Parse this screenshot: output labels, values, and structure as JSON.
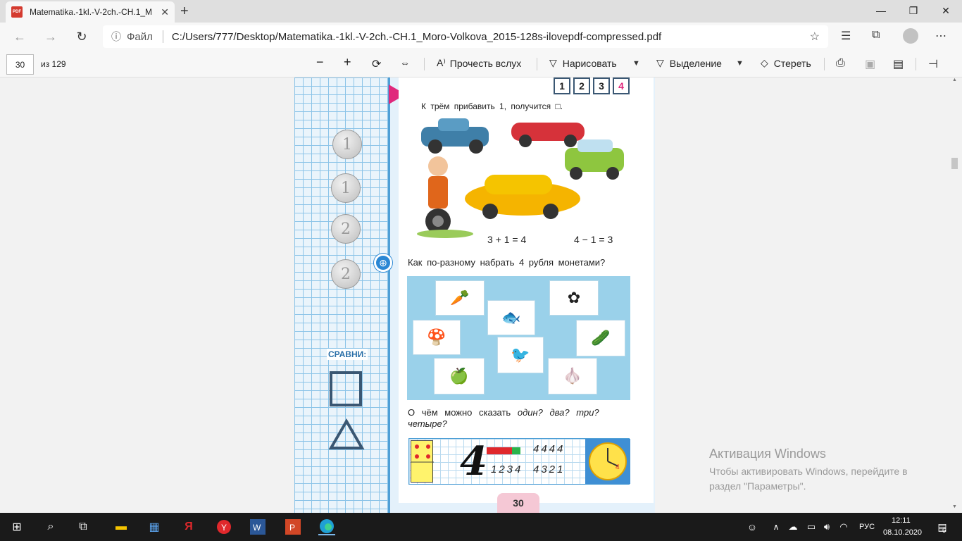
{
  "browser": {
    "tab_title": "Matematika.-1kl.-V-2ch.-CH.1_M",
    "pdf_badge": "PDF",
    "new_tab_symbol": "+",
    "tab_close_symbol": "✕",
    "window_controls": {
      "minimize": "—",
      "restore": "❐",
      "close": "✕"
    }
  },
  "address": {
    "label": "Файл",
    "url": "C:/Users/777/Desktop/Matematika.-1kl.-V-2ch.-CH.1_Moro-Volkova_2015-128s-ilovepdf-compressed.pdf"
  },
  "pdf_toolbar": {
    "page_current": "30",
    "page_total": "из 129",
    "read_aloud": "Прочесть вслух",
    "draw": "Нарисовать",
    "highlight": "Выделение",
    "erase": "Стереть"
  },
  "page": {
    "number_boxes": [
      "1",
      "2",
      "3",
      "4"
    ],
    "line1": "К трём прибавить 1, получится □.",
    "eq1": "3 + 1 = 4",
    "eq2": "4 − 1 = 3",
    "question2": "Как по-разному набрать 4 рубля монетами?",
    "question3_part1": "О чём можно сказать",
    "question3_words": [
      "один?",
      "два?",
      "три?",
      "четыре?"
    ],
    "compare_label": "СРАВНИ:",
    "coins": [
      "1",
      "1",
      "2",
      "2"
    ],
    "seq_top": "4444",
    "seq_left": "1234",
    "seq_right": "4321",
    "big_digit": "4",
    "clock_digit": "4",
    "page_number": "30"
  },
  "activation": {
    "title": "Активация Windows",
    "text": "Чтобы активировать Windows, перейдите в раздел \"Параметры\"."
  },
  "taskbar": {
    "lang": "РУС",
    "time": "12:11",
    "date": "08.10.2020",
    "notif_count": "6"
  },
  "colors": {
    "accent_pink": "#e0287c",
    "grid_blue": "#8cc4e8",
    "panel_blue": "#9ad1ea"
  }
}
